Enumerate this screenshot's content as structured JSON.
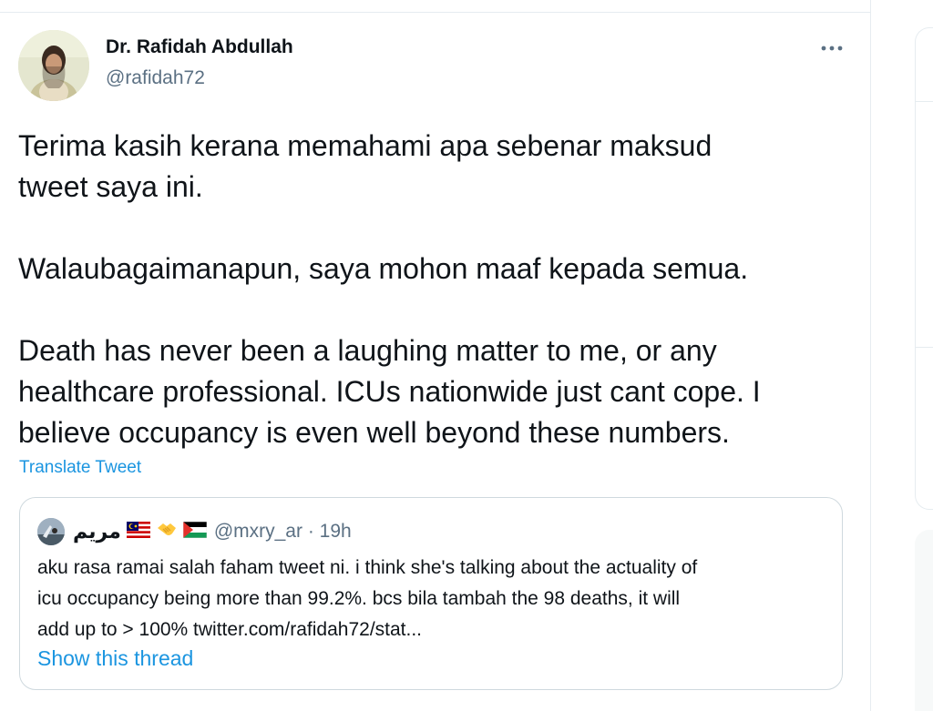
{
  "tweet": {
    "display_name": "Dr. Rafidah Abdullah",
    "handle": "@rafidah72",
    "avatar_icon": "profile-photo-woman-headscarf",
    "more_icon": "more-horizontal-icon",
    "lines_p1": [
      "Terima kasih kerana memahami apa sebenar maksud",
      "tweet saya ini."
    ],
    "lines_p2": [
      "Walaubagaimanapun, saya mohon maaf kepada semua."
    ],
    "lines_p3": [
      "Death has never been a laughing matter to me, or any",
      "healthcare professional. ICUs nationwide just cant cope. I",
      "believe occupancy is even well beyond these numbers."
    ],
    "translate_label": "Translate Tweet"
  },
  "quote": {
    "display_name": "مريم",
    "flags": [
      "malaysia-flag",
      "handshake-emoji",
      "palestine-flag"
    ],
    "handle_time": "@mxry_ar · 19h",
    "lines": [
      "aku rasa ramai salah faham tweet ni. i think she's talking about the actuality of",
      "icu occupancy being more than 99.2%. bcs bila tambah the 98 deaths, it will",
      "add up to > 100% twitter.com/rafidah72/stat..."
    ],
    "show_thread_label": "Show this thread"
  },
  "colors": {
    "text": "#0f1419",
    "secondary": "#5b7083",
    "link": "#1b95e0",
    "border": "#cfd9de"
  }
}
